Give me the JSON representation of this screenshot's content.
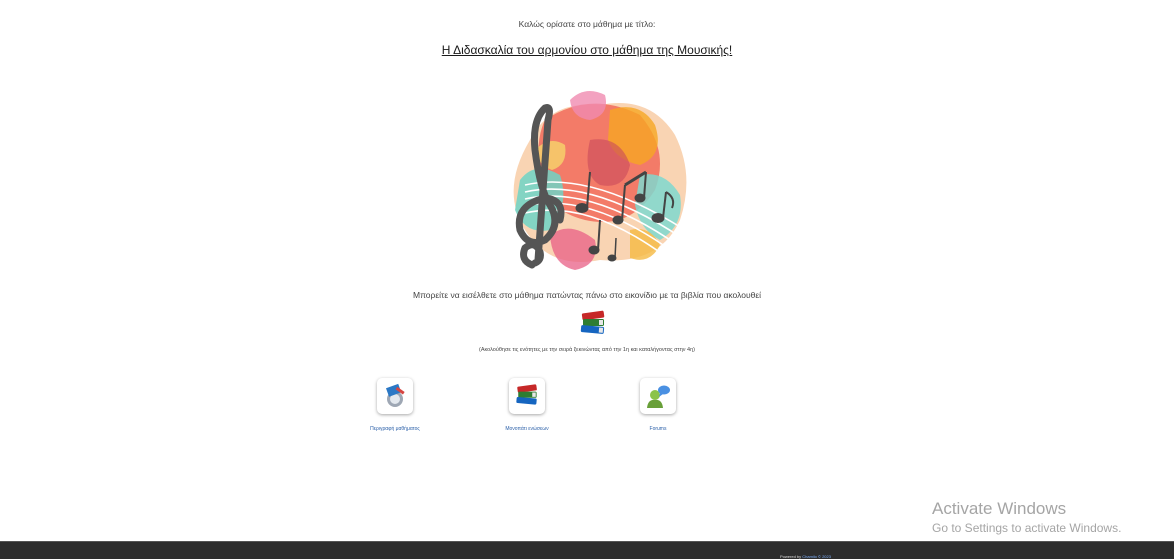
{
  "welcome_text": "Καλώς ορίσατε στο μάθημα με τίτλο:",
  "course_title": "Η Διδασκαλία του αρμονίου στο μάθημα της Μουσικής!",
  "enter_instruction": "Μπορείτε να εισέλθετε στο μάθημα πατώντας πάνω στο εικονίδιο με τα βιβλία που ακολουθεί",
  "order_note": "(Ακολούθησε τις ενότητες με την σειρά ξεκινώντας από την 1η και καταλήγοντας στην 4η)",
  "hero_image": "music-notes-paint-splash",
  "tools": [
    {
      "label": "Περιγραφή μαθήματος",
      "icon": "course-description-icon"
    },
    {
      "label": "Μονοπάτι ενώσεων",
      "icon": "books-icon"
    },
    {
      "label": "Forums",
      "icon": "forum-user-icon"
    }
  ],
  "watermark": {
    "title": "Activate Windows",
    "subtitle": "Go to Settings to activate Windows."
  },
  "footer": {
    "powered_by": "Powered by ",
    "brand": "Chamilo © 2023"
  },
  "colors": {
    "footer_bg": "#2d2d2d",
    "link_blue": "#2a5fa8"
  }
}
